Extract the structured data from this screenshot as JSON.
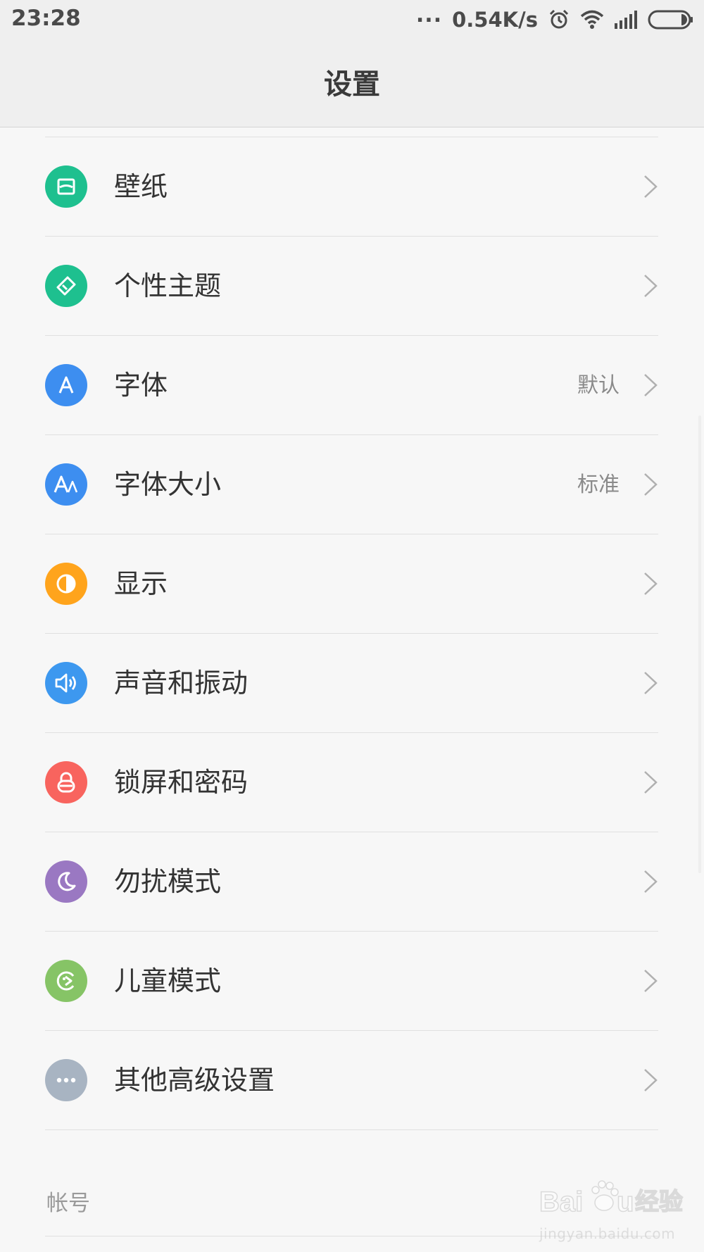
{
  "status_bar": {
    "time": "23:28",
    "dots": "...",
    "network_speed": "0.54K/s",
    "icons": [
      "alarm-icon",
      "wifi-icon",
      "signal-icon",
      "battery-icon"
    ]
  },
  "header": {
    "title": "设置"
  },
  "items": [
    {
      "label": "壁纸",
      "value": "",
      "icon": "wallpaper-icon",
      "color": "#1ec08f"
    },
    {
      "label": "个性主题",
      "value": "",
      "icon": "theme-brush-icon",
      "color": "#1ec08f"
    },
    {
      "label": "字体",
      "value": "默认",
      "icon": "font-icon",
      "color": "#3d8ef0"
    },
    {
      "label": "字体大小",
      "value": "标准",
      "icon": "font-size-icon",
      "color": "#3d8ef0"
    },
    {
      "label": "显示",
      "value": "",
      "icon": "display-icon",
      "color": "#ffa41c"
    },
    {
      "label": "声音和振动",
      "value": "",
      "icon": "speaker-icon",
      "color": "#3d98ef"
    },
    {
      "label": "锁屏和密码",
      "value": "",
      "icon": "lock-icon",
      "color": "#f8645e"
    },
    {
      "label": "勿扰模式",
      "value": "",
      "icon": "moon-icon",
      "color": "#9a78c2"
    },
    {
      "label": "儿童模式",
      "value": "",
      "icon": "kid-mode-icon",
      "color": "#86c466"
    },
    {
      "label": "其他高级设置",
      "value": "",
      "icon": "more-icon",
      "color": "#a8b4c2"
    }
  ],
  "section_header": "帐号",
  "watermark": {
    "logo_text": "Baidu经验",
    "url": "jingyan.baidu.com"
  }
}
